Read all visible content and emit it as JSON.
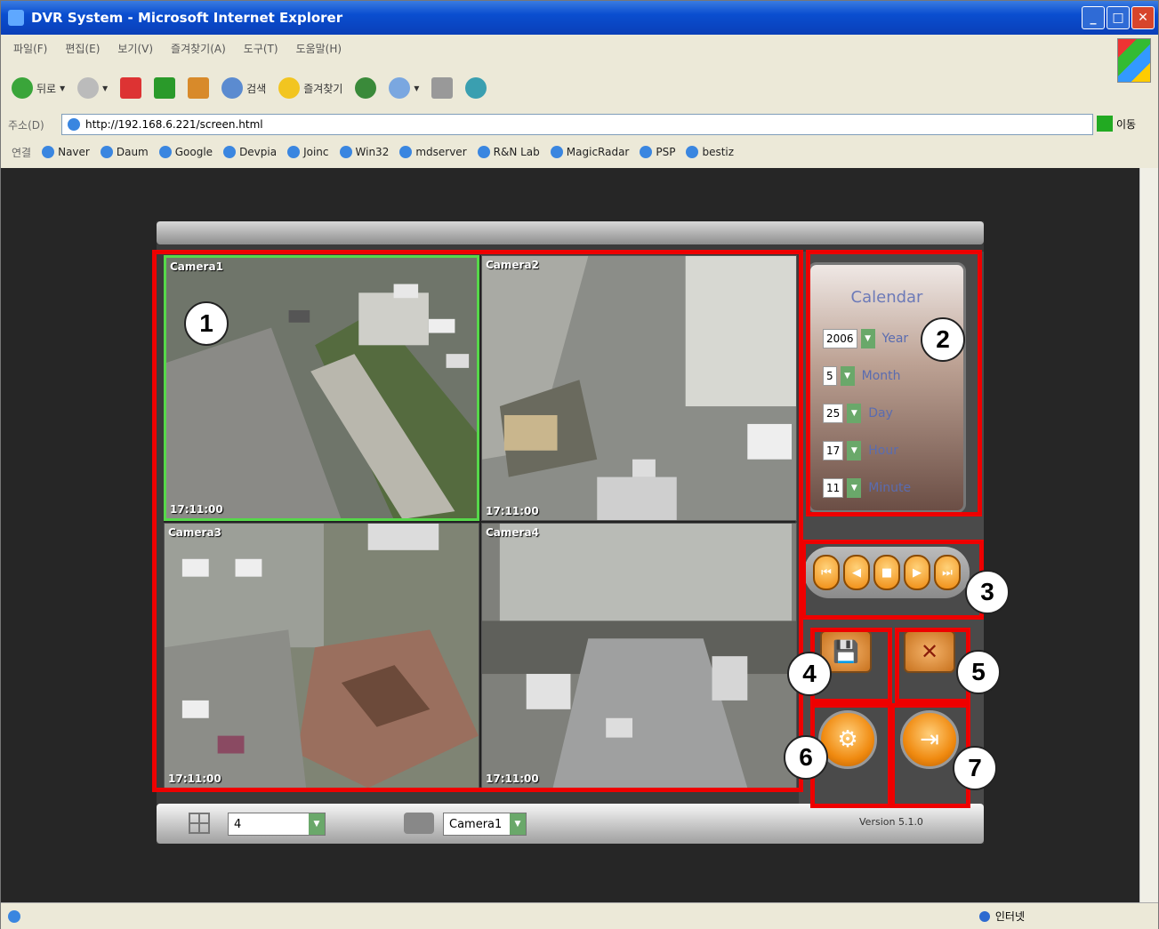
{
  "window": {
    "title": "DVR System - Microsoft Internet Explorer"
  },
  "menu": [
    "파일(F)",
    "편집(E)",
    "보기(V)",
    "즐겨찾기(A)",
    "도구(T)",
    "도움말(H)"
  ],
  "toolbar": {
    "back": "뒤로",
    "search": "검색",
    "favorites": "즐겨찾기"
  },
  "address": {
    "label": "주소(D)",
    "url": "http://192.168.6.221/screen.html",
    "go": "이동"
  },
  "links": {
    "label": "연결",
    "items": [
      "Naver",
      "Daum",
      "Google",
      "Devpia",
      "Joinc",
      "Win32",
      "mdserver",
      "R&N Lab",
      "MagicRadar",
      "PSP",
      "bestiz"
    ]
  },
  "cameras": [
    {
      "name": "Camera1",
      "time": "17:11:00"
    },
    {
      "name": "Camera2",
      "time": "17:11:00"
    },
    {
      "name": "Camera3",
      "time": "17:11:00"
    },
    {
      "name": "Camera4",
      "time": "17:11:00"
    }
  ],
  "calendar": {
    "title": "Calendar",
    "rows": [
      {
        "value": "2006",
        "label": "Year"
      },
      {
        "value": "5",
        "label": "Month"
      },
      {
        "value": "25",
        "label": "Day"
      },
      {
        "value": "17",
        "label": "Hour"
      },
      {
        "value": "11",
        "label": "Minute"
      }
    ]
  },
  "bottom": {
    "split_value": "4",
    "camera_value": "Camera1",
    "version": "Version 5.1.0"
  },
  "annotations": [
    "1",
    "2",
    "3",
    "4",
    "5",
    "6",
    "7"
  ],
  "status": {
    "zone": "인터넷"
  }
}
